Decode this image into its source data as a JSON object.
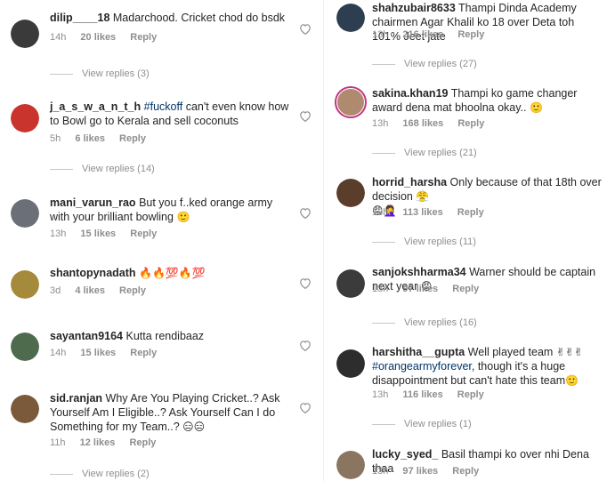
{
  "left": [
    {
      "user": "dilip____18",
      "text": "Madarchood. Cricket chod do bsdk",
      "time": "14h",
      "likes": "20 likes",
      "reply": "Reply",
      "replies": "View replies (3)",
      "avatar_color": "#3a3a3a"
    },
    {
      "user": "j_a_s_w_a_n_t_h",
      "hashtag": "#fuckoff",
      "text": "can't even know how to Bowl go to Kerala and sell coconuts",
      "time": "5h",
      "likes": "6 likes",
      "reply": "Reply",
      "replies": "View replies (14)",
      "avatar_color": "#c9342d"
    },
    {
      "user": "mani_varun_rao",
      "text": "But you f..ked orange army with your brilliant bowling",
      "emoji": "🙂",
      "time": "13h",
      "likes": "15 likes",
      "reply": "Reply",
      "avatar_color": "#6b6f78"
    },
    {
      "user": "shantopynadath",
      "emoji": "🔥🔥💯🔥💯",
      "time": "3d",
      "likes": "4 likes",
      "reply": "Reply",
      "avatar_color": "#a68a3c"
    },
    {
      "user": "sayantan9164",
      "text": "Kutta rendibaaz",
      "time": "14h",
      "likes": "15 likes",
      "reply": "Reply",
      "avatar_color": "#4f6b4e"
    },
    {
      "user": "sid.ranjan",
      "text": "Why Are You Playing Cricket..? Ask Yourself Am I Eligible..? Ask Yourself Can I do Something for my Team..?",
      "emoji": "😑😑",
      "time": "11h",
      "likes": "12 likes",
      "reply": "Reply",
      "replies": "View replies (2)",
      "avatar_color": "#7a5a3a"
    }
  ],
  "right": [
    {
      "user": "shahzubair8633",
      "text": "Thampi Dinda Academy chairmen Agar Khalil ko 18 over Deta toh 101% Jeet jate",
      "time": "13h",
      "likes": "216 likes",
      "reply": "Reply",
      "replies": "View replies (27)",
      "avatar_color": "#2c3e50"
    },
    {
      "user": "sakina.khan19",
      "text": "Thampi ko game changer award dena mat bhoolna okay..",
      "emoji": "🙂",
      "time": "13h",
      "likes": "168 likes",
      "reply": "Reply",
      "replies": "View replies (21)",
      "avatar_color": "#b08a6e"
    },
    {
      "user": "horrid_harsha",
      "text": "Only because of that 18th over decision",
      "emoji": "😤",
      "emoji2": "😡🤦‍♀️",
      "time": "13h",
      "likes": "113 likes",
      "reply": "Reply",
      "replies": "View replies (11)",
      "avatar_color": "#5a3d2b"
    },
    {
      "user": "sanjokshharma34",
      "text": "Warner should be captain next year",
      "emoji": "😡",
      "time": "13h",
      "likes": "97 likes",
      "reply": "Reply",
      "replies": "View replies (16)",
      "avatar_color": "#3b3b3b"
    },
    {
      "user": "harshitha__gupta",
      "text": "Well played team",
      "emoji": "✌✌✌",
      "hashtag": "#orangearmyforever",
      "text2": ", though it's a huge disappointment but can't hate this team",
      "emoji2": "🙂",
      "time": "13h",
      "likes": "116 likes",
      "reply": "Reply",
      "replies": "View replies (1)",
      "avatar_color": "#2d2d2d"
    },
    {
      "user": "lucky_syed_",
      "text": "Basil thampi ko over nhi Dena thaa",
      "time": "13h",
      "likes": "97 likes",
      "reply": "Reply",
      "avatar_color": "#8a7560"
    }
  ],
  "colors": {
    "meta": "#8e8e8e",
    "text": "#262626",
    "hashtag": "#003569",
    "story_ring": "#c13584"
  }
}
